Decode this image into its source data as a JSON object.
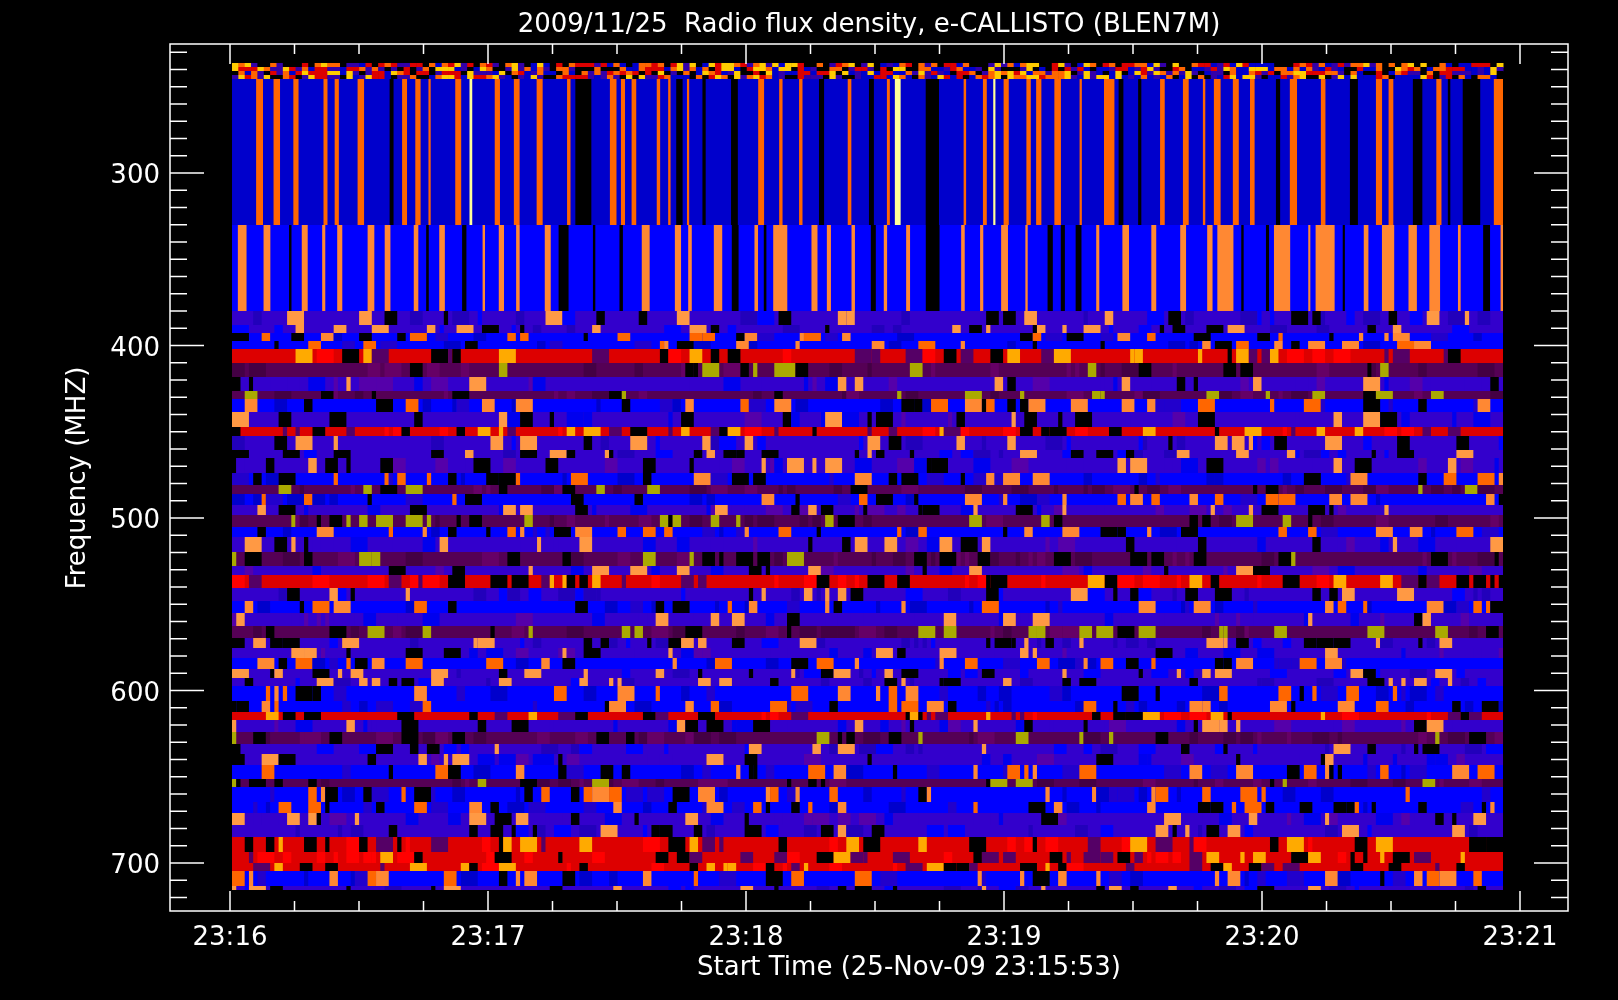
{
  "title": "2009/11/25  Radio flux density, e-CALLISTO (BLEN7M)",
  "y_axis": {
    "label": "Frequency (MHZ)",
    "ticks": [
      "300",
      "400",
      "500",
      "600",
      "700"
    ]
  },
  "x_axis": {
    "label": "Start Time (25-Nov-09 23:15:53)",
    "ticks": [
      "23:16",
      "23:17",
      "23:18",
      "23:19",
      "23:20",
      "23:21"
    ]
  }
}
